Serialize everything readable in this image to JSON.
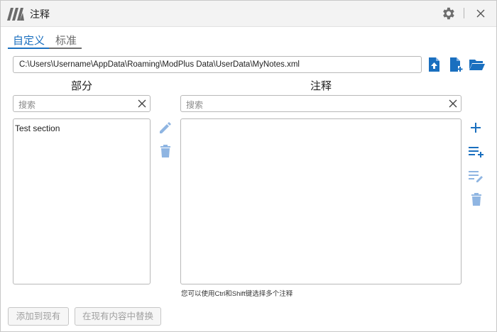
{
  "window": {
    "title": "注释"
  },
  "tabs": [
    {
      "label": "自定义",
      "active": true
    },
    {
      "label": "标准",
      "active": false
    }
  ],
  "file": {
    "path": "C:\\Users\\Username\\AppData\\Roaming\\ModPlus Data\\UserData\\MyNotes.xml"
  },
  "sections": {
    "header": "部分",
    "search_placeholder": "搜索",
    "items": [
      "Test section"
    ]
  },
  "notes": {
    "header": "注释",
    "search_placeholder": "搜索",
    "hint": "您可以使用Ctrl和Shift键选择多个注释"
  },
  "buttons": {
    "add_to_existing": "添加到现有",
    "replace_in_existing": "在现有内容中替换"
  },
  "colors": {
    "accent": "#1a6fbf",
    "icon_blue": "#3b82d6",
    "icon_disabled": "#8fb5e2",
    "logo_grey": "#6b6b6b"
  },
  "icons": {
    "titlebar": [
      "logo-icon",
      "gear-icon",
      "close-icon"
    ],
    "file": [
      "upload-file-icon",
      "new-file-icon",
      "open-folder-icon"
    ],
    "sections": [
      "edit-icon",
      "delete-icon"
    ],
    "notes": [
      "add-icon",
      "add-list-icon",
      "edit-list-icon",
      "delete-icon"
    ]
  }
}
